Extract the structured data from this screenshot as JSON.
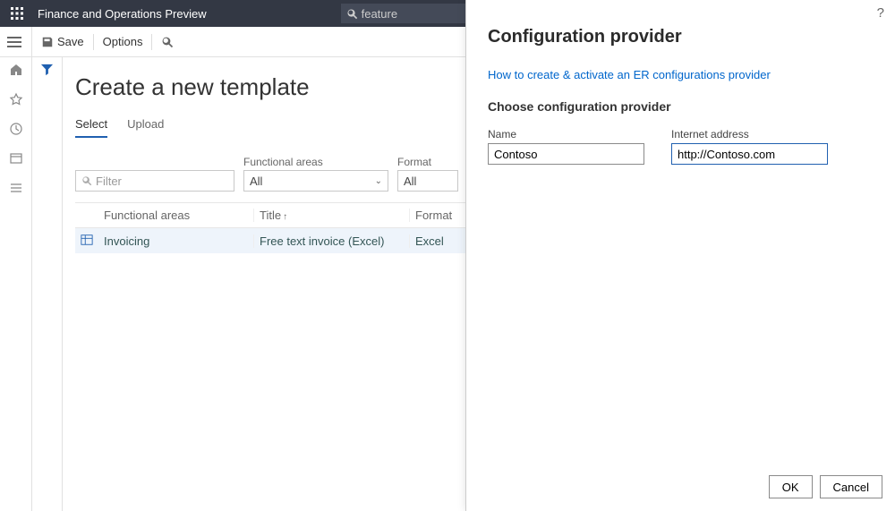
{
  "header": {
    "appTitle": "Finance and Operations Preview",
    "searchText": "feature"
  },
  "actions": {
    "save": "Save",
    "options": "Options"
  },
  "page": {
    "title": "Create a new template",
    "tabs": {
      "select": "Select",
      "upload": "Upload"
    }
  },
  "filters": {
    "filterPlaceholder": "Filter",
    "functionalAreasLabel": "Functional areas",
    "functionalAreasValue": "All",
    "formatLabel": "Format",
    "formatValue": "All"
  },
  "grid": {
    "headers": {
      "functionalAreas": "Functional areas",
      "title": "Title",
      "format": "Format"
    },
    "rows": [
      {
        "functionalAreas": "Invoicing",
        "title": "Free text invoice (Excel)",
        "format": "Excel"
      }
    ]
  },
  "panel": {
    "title": "Configuration provider",
    "helpLink": "How to create & activate an ER configurations provider",
    "subtitle": "Choose configuration provider",
    "fields": {
      "nameLabel": "Name",
      "nameValue": "Contoso",
      "addressLabel": "Internet address",
      "addressValue": "http://Contoso.com"
    },
    "buttons": {
      "ok": "OK",
      "cancel": "Cancel"
    }
  }
}
